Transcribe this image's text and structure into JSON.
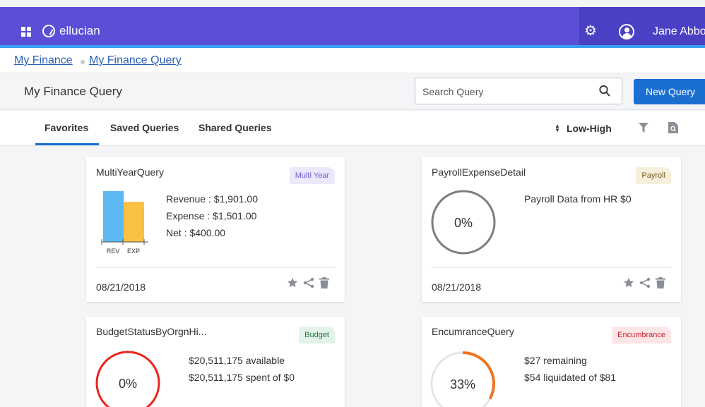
{
  "header": {
    "brand": "ellucian",
    "user_name": "Jane Abbo",
    "colors": {
      "bar": "#5a4fd6",
      "bar_right": "#4a40c4",
      "strip": "#3aa0f0"
    }
  },
  "breadcrumb": {
    "items": [
      "My Finance",
      "My Finance Query"
    ]
  },
  "page": {
    "title": "My Finance Query",
    "search_placeholder": "Search Query",
    "new_query_label": "New Query"
  },
  "tabs": {
    "items": [
      "Favorites",
      "Saved Queries",
      "Shared Queries"
    ],
    "active": "Favorites",
    "sort_label": "Low-High"
  },
  "cards": [
    {
      "title": "MultiYearQuery",
      "tag": "Multi Year",
      "tag_color": "#6a5acd",
      "tag_bg": "#ece8fb",
      "lines": [
        "Revenue : $1,901.00",
        "Expense : $1,501.00",
        "Net : $400.00"
      ],
      "chart_data": {
        "type": "bar",
        "categories": [
          "REV",
          "EXP"
        ],
        "values": [
          1901,
          1501
        ],
        "colors": [
          "#5bb8f0",
          "#f9c142"
        ]
      },
      "date": "08/21/2018"
    },
    {
      "title": "PayrollExpenseDetail",
      "tag": "Payroll",
      "tag_color": "#7a5b22",
      "tag_bg": "#f6efdb",
      "lines": [
        "Payroll Data from HR $0"
      ],
      "percent": "0%",
      "progress": 0,
      "ring_color": "#7d7d7d",
      "date": "08/21/2018"
    },
    {
      "title": "BudgetStatusByOrgnHi...",
      "tag": "Budget",
      "tag_color": "#1e7a45",
      "tag_bg": "#e3f3e9",
      "lines": [
        "$20,511,175 available",
        "$20,511,175 spent of $0"
      ],
      "percent": "0%",
      "progress": 0,
      "ring_color": "#e8251c"
    },
    {
      "title": "EncumranceQuery",
      "tag": "Encumbrance",
      "tag_color": "#c4242c",
      "tag_bg": "#fbe5e6",
      "lines": [
        "$27 remaining",
        "$54 liquidated of $81"
      ],
      "percent": "33%",
      "progress": 0.33,
      "ring_color": "#f07320",
      "ring_track": "#e5e5e5"
    }
  ]
}
